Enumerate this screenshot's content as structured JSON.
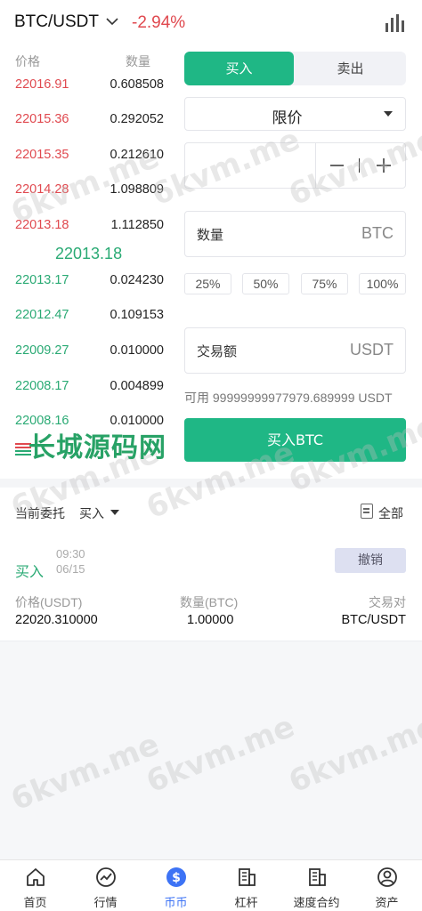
{
  "header": {
    "pair": "BTC/USDT",
    "change": "-2.94%",
    "change_color": "#e0494f"
  },
  "orderbook": {
    "price_label": "价格",
    "qty_label": "数量",
    "asks": [
      {
        "price": "22016.91",
        "qty": "0.608508"
      },
      {
        "price": "22015.36",
        "qty": "0.292052"
      },
      {
        "price": "22015.35",
        "qty": "0.212610"
      },
      {
        "price": "22014.28",
        "qty": "1.098809"
      },
      {
        "price": "22013.18",
        "qty": "1.112850"
      }
    ],
    "mid_price": "22013.18",
    "bids": [
      {
        "price": "22013.17",
        "qty": "0.024230"
      },
      {
        "price": "22012.47",
        "qty": "0.109153"
      },
      {
        "price": "22009.27",
        "qty": "0.010000"
      },
      {
        "price": "22008.17",
        "qty": "0.004899"
      },
      {
        "price": "22008.16",
        "qty": "0.010000"
      }
    ]
  },
  "trade": {
    "tab_buy": "买入",
    "tab_sell": "卖出",
    "order_type": "限价",
    "amount_label": "数量",
    "amount_unit": "BTC",
    "percents": [
      "25%",
      "50%",
      "75%",
      "100%"
    ],
    "total_label": "交易额",
    "total_unit": "USDT",
    "available": "可用 99999999977979.689999 USDT",
    "buy_button": "买入BTC"
  },
  "orders": {
    "title": "当前委托",
    "filter": "买入",
    "all_label": "全部",
    "items": [
      {
        "side": "买入",
        "time": "09:30",
        "date": "06/15",
        "cancel": "撤销",
        "price_label": "价格(USDT)",
        "qty_label": "数量(BTC)",
        "pair_label": "交易对",
        "price": "22020.310000",
        "qty": "1.00000",
        "pair": "BTC/USDT"
      }
    ]
  },
  "tabbar": {
    "items": [
      {
        "label": "首页",
        "icon": "home-icon"
      },
      {
        "label": "行情",
        "icon": "market-icon"
      },
      {
        "label": "币币",
        "icon": "dollar-icon"
      },
      {
        "label": "杠杆",
        "icon": "building-icon"
      },
      {
        "label": "速度合约",
        "icon": "contract-icon"
      },
      {
        "label": "资产",
        "icon": "user-icon"
      }
    ],
    "active_index": 2
  },
  "watermarks": {
    "domain": "6kvm.me",
    "brand": "长城源码网"
  },
  "colors": {
    "buy": "#1fb785",
    "sell": "#e0494f",
    "active_nav": "#3d73f5"
  }
}
